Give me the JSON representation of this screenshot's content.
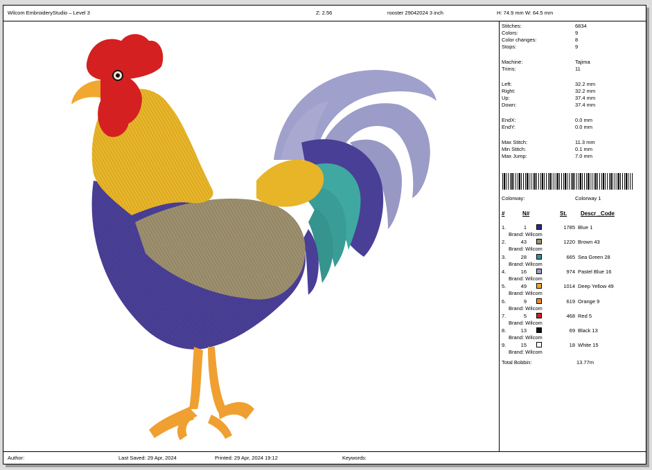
{
  "header": {
    "app_title": "Wilcom EmbroideryStudio – Level 3",
    "zoom": "Z: 2.56",
    "file_name": "rooster 29042024 3 inch",
    "dimensions": "H: 74.9 mm   W: 64.5 mm"
  },
  "stats": [
    {
      "label": "Stitches:",
      "value": "6834"
    },
    {
      "label": "Colors:",
      "value": "9"
    },
    {
      "label": "Color changes:",
      "value": "8"
    },
    {
      "label": "Stops:",
      "value": "9"
    },
    {
      "label": "Machine:",
      "value": "Tajima"
    },
    {
      "label": "Trims:",
      "value": "11"
    },
    {
      "label": "Left:",
      "value": "32.2 mm"
    },
    {
      "label": "Right:",
      "value": "32.2 mm"
    },
    {
      "label": "Up:",
      "value": "37.4 mm"
    },
    {
      "label": "Down:",
      "value": "37.4 mm"
    },
    {
      "label": "EndX:",
      "value": "0.0 mm"
    },
    {
      "label": "EndY:",
      "value": "0.0 mm"
    },
    {
      "label": "Max Stitch:",
      "value": "11.3 mm"
    },
    {
      "label": "Min Stitch:",
      "value": "0.1 mm"
    },
    {
      "label": "Max Jump:",
      "value": "7.0 mm"
    }
  ],
  "colorway": {
    "label": "Colorway:",
    "value": "Colorway 1"
  },
  "color_table": {
    "headers": {
      "index": "#",
      "number": "N#",
      "stitches": "St.",
      "descr": "Descr _Code"
    },
    "rows": [
      {
        "index": "1.",
        "number": "1",
        "stitches": "1785",
        "descr": "Blue 1",
        "brand": "Brand: Wilcom",
        "color": "#2a2a8c"
      },
      {
        "index": "2.",
        "number": "43",
        "stitches": "1220",
        "descr": "Brown 43",
        "brand": "Brand: Wilcom",
        "color": "#9c8f6e"
      },
      {
        "index": "3.",
        "number": "28",
        "stitches": "665",
        "descr": "Sea Green 28",
        "brand": "Brand: Wilcom",
        "color": "#3f8f9a"
      },
      {
        "index": "4.",
        "number": "16",
        "stitches": "974",
        "descr": "Pastel Blue 16",
        "brand": "Brand: Wilcom",
        "color": "#9a9ac8"
      },
      {
        "index": "5.",
        "number": "49",
        "stitches": "1014",
        "descr": "Deep Yellow 49",
        "brand": "Brand: Wilcom",
        "color": "#f0a830"
      },
      {
        "index": "6.",
        "number": "9",
        "stitches": "619",
        "descr": "Orange 9",
        "brand": "Brand: Wilcom",
        "color": "#f08a20"
      },
      {
        "index": "7.",
        "number": "5",
        "stitches": "468",
        "descr": "Red 5",
        "brand": "Brand: Wilcom",
        "color": "#d42020"
      },
      {
        "index": "8.",
        "number": "13",
        "stitches": "69",
        "descr": "Black 13",
        "brand": "Brand: Wilcom",
        "color": "#111111"
      },
      {
        "index": "9.",
        "number": "15",
        "stitches": "18",
        "descr": "White 15",
        "brand": "Brand: Wilcom",
        "color": "#ffffff"
      }
    ]
  },
  "total_bobbin": {
    "label": "Total Bobbin:",
    "value": "13.77m"
  },
  "footer": {
    "author": "Author:",
    "last_saved": "Last Saved: 29 Apr, 2024",
    "printed": "Printed: 29 Apr, 2024 19:12",
    "keywords": "Keywords:"
  }
}
